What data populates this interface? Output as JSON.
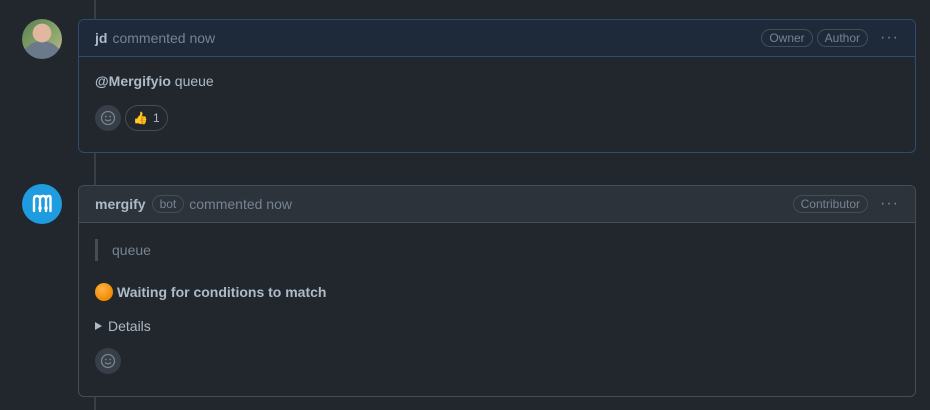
{
  "comments": [
    {
      "author": "jd",
      "meta": "commented now",
      "badges": [
        "Owner",
        "Author"
      ],
      "more": "···",
      "body_mention": "@Mergifyio",
      "body_text": " queue",
      "reaction": {
        "emoji": "👍",
        "count": "1"
      }
    },
    {
      "author": "mergify",
      "bot_badge": "bot",
      "meta": "commented now",
      "badges": [
        "Contributor"
      ],
      "more": "···",
      "quote": "queue",
      "status": "Waiting for conditions to match",
      "details": "Details"
    }
  ]
}
